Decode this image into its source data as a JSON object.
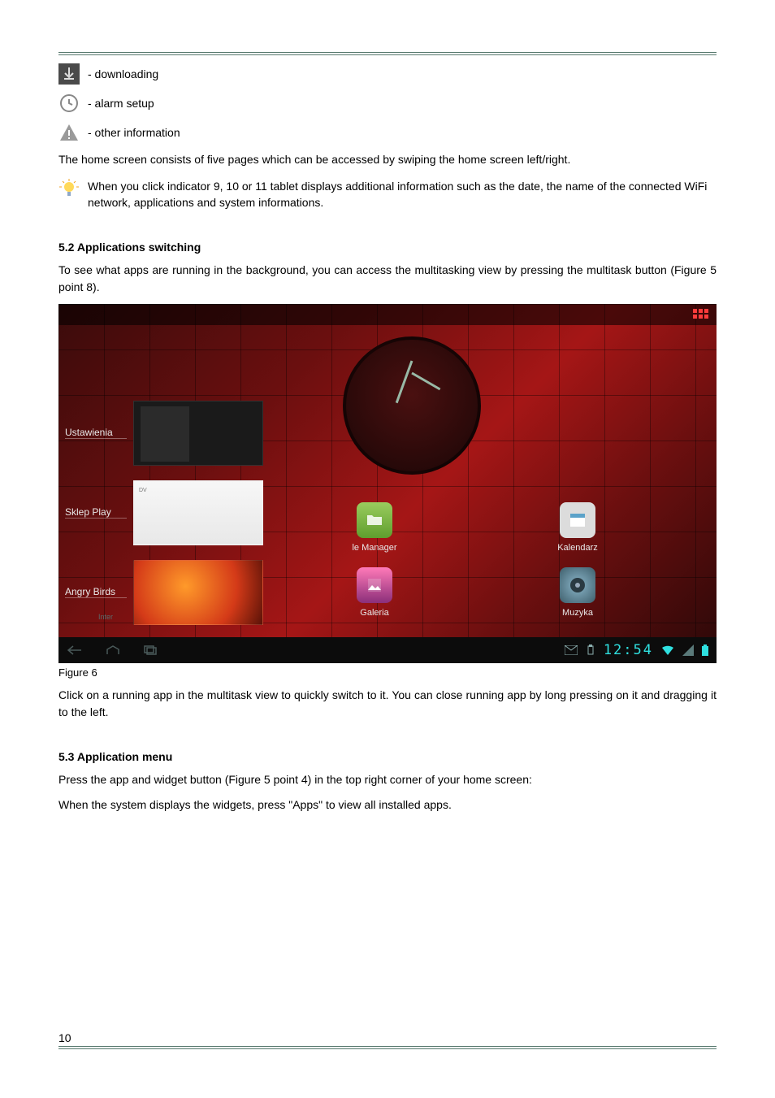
{
  "icons": {
    "downloading": "- downloading",
    "alarm": "- alarm setup",
    "other": "- other information"
  },
  "p1": "The home screen consists of five pages which can be accessed by swiping the home screen left/right.",
  "tip": "When you click indicator 9, 10 or 11 tablet displays additional information such as the date, the name of the connected WiFi network, applications and system informations.",
  "h52": "5.2 Applications switching",
  "p2": "To see what apps are running in the background, you can access the multitasking view by pressing the multitask button (Figure 5 point 8).",
  "shot": {
    "mt": {
      "ustawienia": "Ustawienia",
      "sklep": "Sklep Play",
      "ab": "Angry Birds",
      "dv": "DV",
      "inter": "Inter"
    },
    "apps": {
      "fm": "le Manager",
      "cal": "Kalendarz",
      "play": "Sklep Play",
      "gal": "Galeria",
      "muz": "Muzyka",
      "set": "Ustawienia"
    },
    "time": "12:54"
  },
  "caption": "Figure 6",
  "p3": "Click on a running app in the multitask view to quickly switch to it. You can close running app by long pressing on it and dragging it to the left.",
  "h53": "5.3 Application menu",
  "p4": "Press the app and widget button (Figure 5 point 4) in the top right corner of your home screen:",
  "p5": "When the system displays the widgets, press \"Apps\" to view all installed apps.",
  "pageNum": "10"
}
